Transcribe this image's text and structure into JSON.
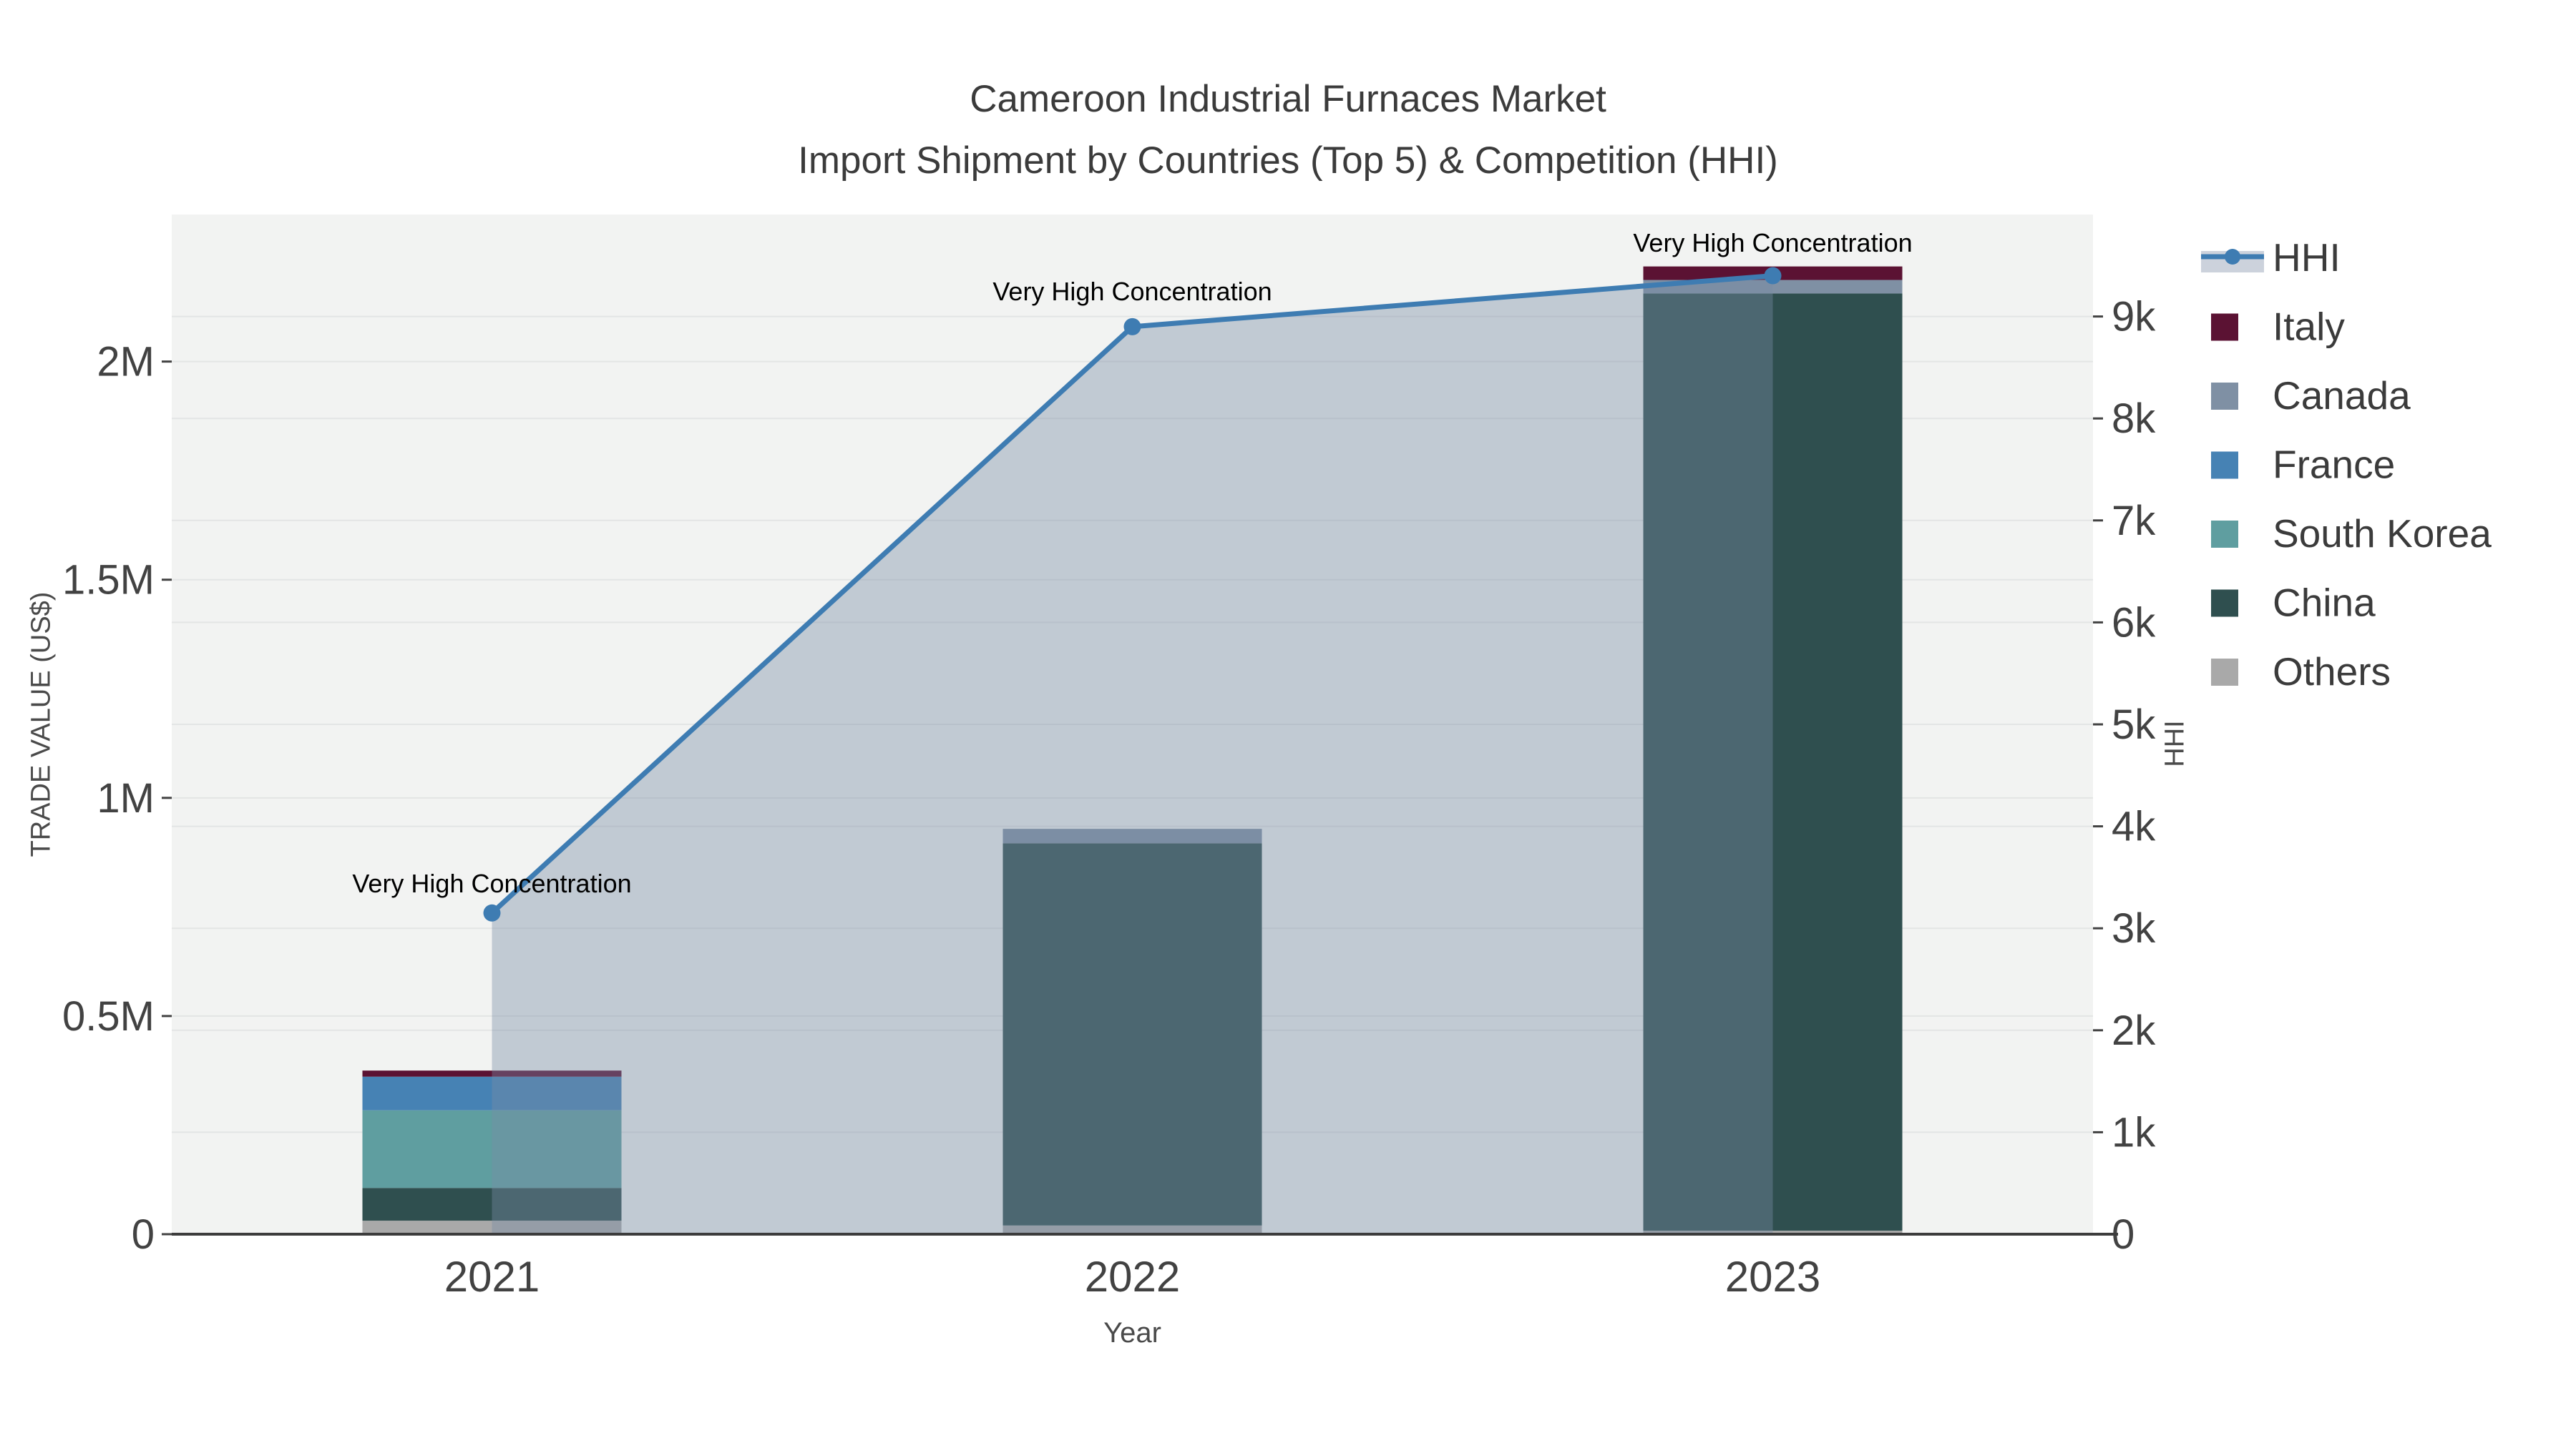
{
  "title": {
    "line1": "Cameroon Industrial Furnaces Market",
    "line2": "Import Shipment by Countries (Top 5) & Competition (HHI)"
  },
  "axes": {
    "x": {
      "title": "Year",
      "tick_labels": [
        "2021",
        "2022",
        "2023"
      ]
    },
    "y_left": {
      "title": "TRADE VALUE (US$)",
      "tick_labels": [
        "0",
        "0.5M",
        "1M",
        "1.5M",
        "2M"
      ],
      "tick_values": [
        0,
        500000,
        1000000,
        1500000,
        2000000
      ],
      "range": [
        0,
        2337000
      ]
    },
    "y_right": {
      "title": "HHI",
      "tick_labels": [
        "0",
        "1k",
        "2k",
        "3k",
        "4k",
        "5k",
        "6k",
        "7k",
        "8k",
        "9k"
      ],
      "tick_values": [
        0,
        1000,
        2000,
        3000,
        4000,
        5000,
        6000,
        7000,
        8000,
        9000
      ],
      "range": [
        0,
        10000
      ]
    }
  },
  "chart_data": {
    "type": "bar+line",
    "categories": [
      "2021",
      "2022",
      "2023"
    ],
    "bar_stack_order_note": "bottom to top",
    "series": [
      {
        "name": "Others",
        "color": "#A9A9A9",
        "values": [
          31000,
          20000,
          8000
        ]
      },
      {
        "name": "China",
        "color": "#2F4F4F",
        "values": [
          75000,
          876000,
          2148000
        ]
      },
      {
        "name": "South Korea",
        "color": "#5F9EA0",
        "values": [
          178000,
          0,
          0
        ]
      },
      {
        "name": "France",
        "color": "#4682B4",
        "values": [
          77000,
          0,
          0
        ]
      },
      {
        "name": "Canada",
        "color": "#7F90A4",
        "values": [
          0,
          33000,
          31000
        ]
      },
      {
        "name": "Italy",
        "color": "#5B1233",
        "values": [
          14000,
          0,
          31000
        ]
      }
    ],
    "line_series": {
      "name": "HHI",
      "color": "#3E7CB2",
      "area_color": "rgba(121,141,165,0.40)",
      "values": [
        3150,
        8900,
        9400
      ]
    },
    "annotations": [
      {
        "year": "2021",
        "text": "Very High Concentration"
      },
      {
        "year": "2022",
        "text": "Very High Concentration"
      },
      {
        "year": "2023",
        "text": "Very High Concentration"
      }
    ],
    "bar_totals": [
      375000,
      929000,
      2218000
    ],
    "legend_position": "right",
    "grid": true
  },
  "legend": {
    "entries": [
      {
        "label": "HHI",
        "type": "line",
        "color": "#3E7CB2",
        "band_color": "#CCD2DC"
      },
      {
        "label": "Italy",
        "type": "swatch",
        "color": "#5B1233"
      },
      {
        "label": "Canada",
        "type": "swatch",
        "color": "#7F90A4"
      },
      {
        "label": "France",
        "type": "swatch",
        "color": "#4682B4"
      },
      {
        "label": "South Korea",
        "type": "swatch",
        "color": "#5F9EA0"
      },
      {
        "label": "China",
        "type": "swatch",
        "color": "#2F4F4F"
      },
      {
        "label": "Others",
        "type": "swatch",
        "color": "#A9A9A9"
      }
    ]
  },
  "colors": {
    "plot_background": "#F2F3F2",
    "gridline": "#E3E5E5",
    "axis_line": "#3C3C3C",
    "tick_text": "#424242",
    "annotation_text": "#000000"
  }
}
